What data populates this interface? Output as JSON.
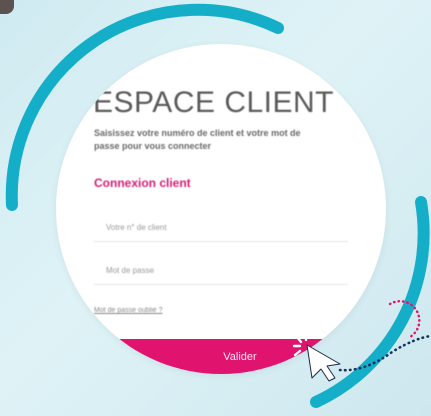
{
  "login": {
    "title": "ESPACE CLIENT",
    "subtitle": "Saisissez votre numéro de client et votre mot de passe pour vous connecter",
    "section_label": "Connexion client",
    "client_field": {
      "placeholder": "Votre n° de client",
      "value": ""
    },
    "password_field": {
      "placeholder": "Mot de passe",
      "value": ""
    },
    "forgot_link": "Mot de passe oublié ?",
    "submit_label": "Valider"
  },
  "colors": {
    "accent": "#e0136f",
    "ring": "#15aec8",
    "dots": "#17335f",
    "background": "#d7eef3"
  },
  "icons": {
    "cursor": "pointer-arrow-icon",
    "click_burst": "click-burst-icon"
  }
}
